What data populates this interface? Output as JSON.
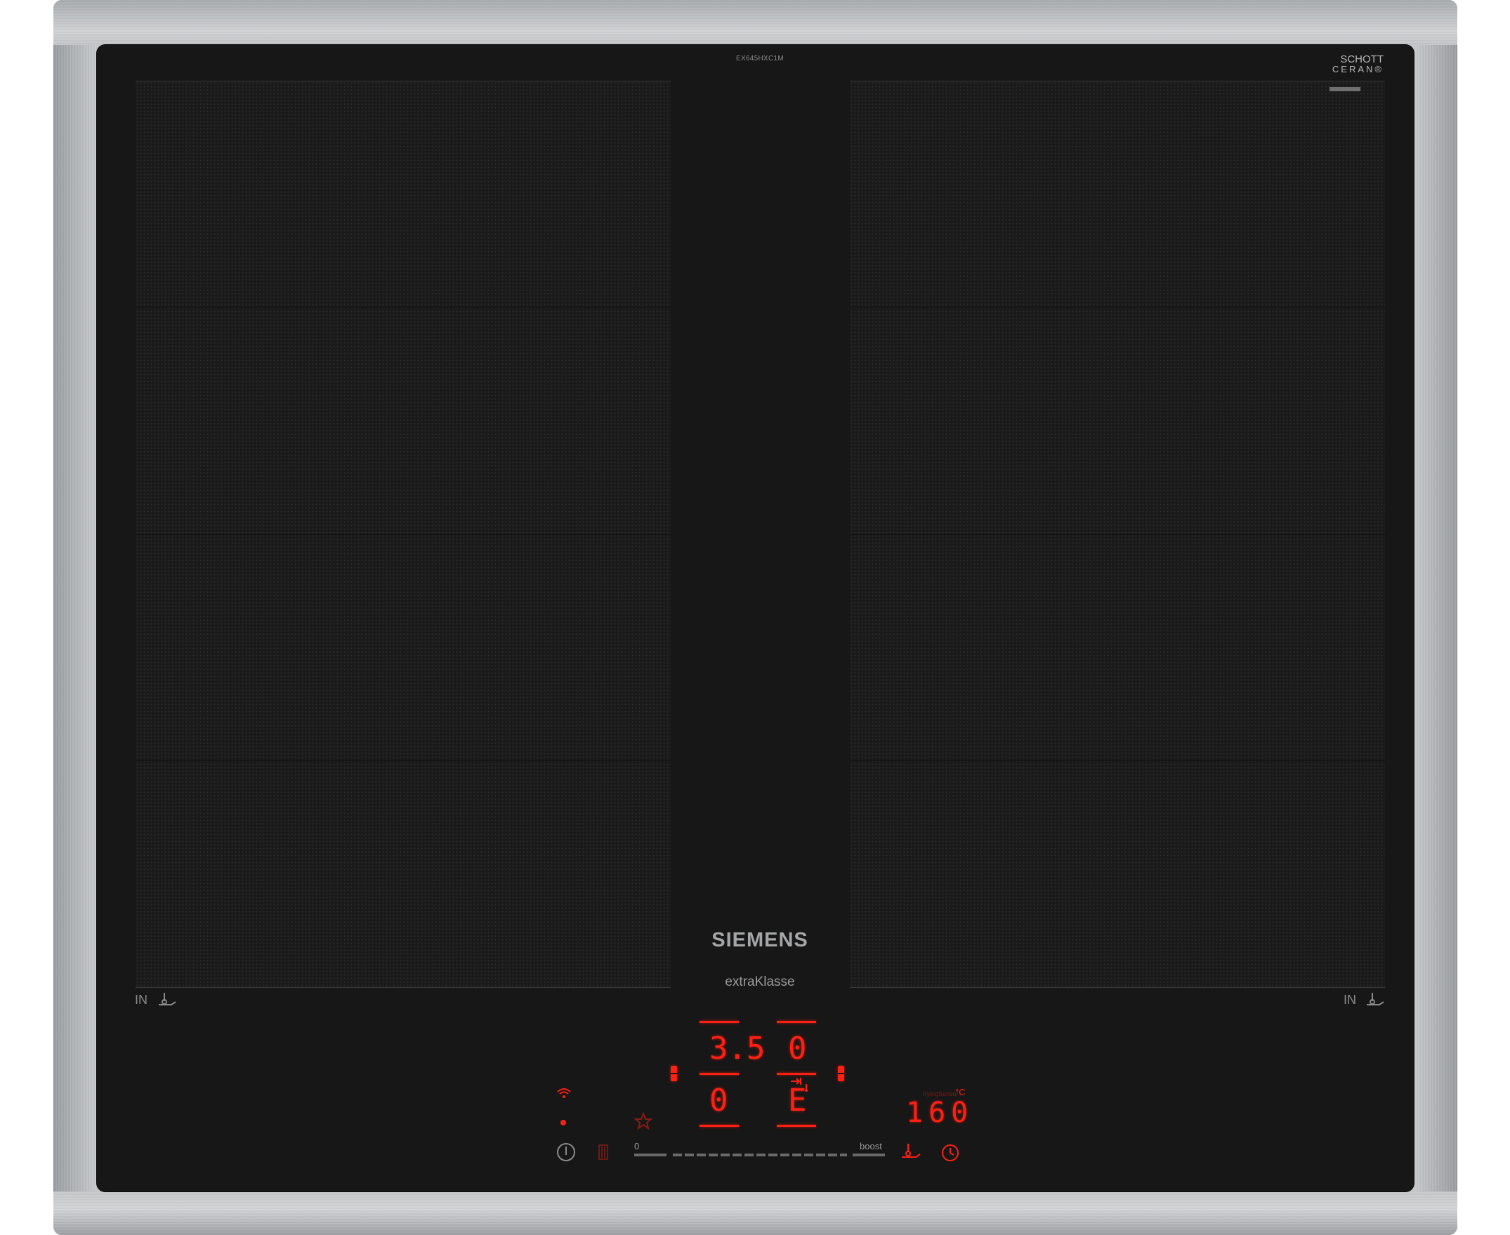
{
  "product": {
    "model_number": "EX645HXC1M",
    "glass_brand_line1": "SCHOTT",
    "glass_brand_line2": "CERAN®",
    "brand": "SIEMENS",
    "series": "extraKlasse"
  },
  "zones": {
    "left_label": "IN",
    "right_label": "IN"
  },
  "controls": {
    "zone_front_left_level": "3.5",
    "zone_rear_left_level": "0",
    "zone_front_right_level": "0",
    "zone_rear_right_level": "E",
    "temp_label": "fryingSensor",
    "temp_unit": "°C",
    "temp_value": "160",
    "slider_min_label": "0",
    "slider_max_label": "boost"
  },
  "icons": {
    "wifi": "wifi-icon",
    "power": "power-icon",
    "lock": "childlock-icon",
    "favorite": "star-icon",
    "frying_sensor": "pan-sensor-icon",
    "timer": "timer-icon",
    "move": "move-function-icon"
  },
  "colors": {
    "display_red": "#ff2014",
    "glass": "#171717",
    "frame": "#bfc2c4"
  }
}
